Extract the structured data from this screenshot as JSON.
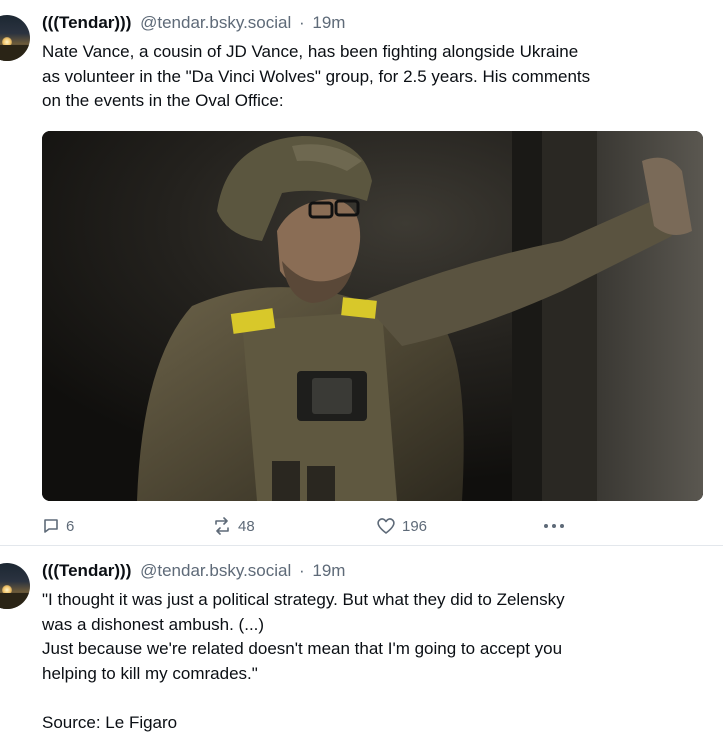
{
  "posts": [
    {
      "author_name": "(((Tendar)))",
      "author_handle": "@tendar.bsky.social",
      "separator": "·",
      "time": "19m",
      "text": "Nate Vance, a cousin of JD Vance, has been fighting alongside Ukraine\nas volunteer in the \"Da Vinci Wolves\" group, for 2.5 years. His comments\non the events in the Oval Office:",
      "image": "soldier-photo",
      "stats": {
        "replies": "6",
        "reposts": "48",
        "likes": "196"
      }
    },
    {
      "author_name": "(((Tendar)))",
      "author_handle": "@tendar.bsky.social",
      "separator": "·",
      "time": "19m",
      "text": "\"I thought it was just a political strategy. But what they did to Zelensky\nwas a dishonest ambush. (...)\nJust because we're related doesn't mean that I'm going to accept you\nhelping to kill my comrades.\"\n\nSource: Le Figaro"
    }
  ],
  "icons": {
    "reply": "reply-icon",
    "repost": "repost-icon",
    "like": "heart-icon",
    "more": "more-options-icon"
  },
  "colors": {
    "text": "#0b0f14",
    "muted": "#5e6a78",
    "divider": "#e3e7ec"
  }
}
